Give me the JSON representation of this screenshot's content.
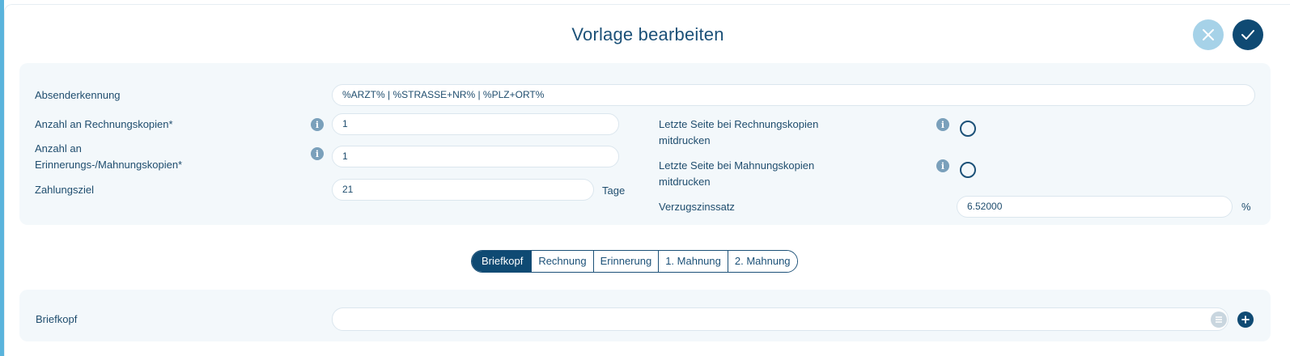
{
  "dialog": {
    "title": "Vorlage bearbeiten",
    "cancel_icon": "close-icon",
    "confirm_icon": "check-icon"
  },
  "form": {
    "absenderkennung_label": "Absenderkennung",
    "absenderkennung_value": "%ARZT% | %STRASSE+NR% | %PLZ+ORT%",
    "rechnungskopien_label": "Anzahl an Rechnungskopien*",
    "rechnungskopien_value": "1",
    "mahnungskopien_label_line1": "Anzahl an",
    "mahnungskopien_label_line2": "Erinnerungs-/Mahnungskopien*",
    "mahnungskopien_value": "1",
    "zahlungsziel_label": "Zahlungsziel",
    "zahlungsziel_value": "21",
    "zahlungsziel_unit": "Tage",
    "letzte_rechnung_label_line1": "Letzte Seite bei Rechnungskopien",
    "letzte_rechnung_label_line2": "mitdrucken",
    "letzte_mahnung_label_line1": "Letzte Seite bei Mahnungskopien",
    "letzte_mahnung_label_line2": "mitdrucken",
    "verzugszinssatz_label": "Verzugszinssatz",
    "verzugszinssatz_value": "6.52000",
    "verzugszinssatz_unit": "%",
    "info_glyph": "i"
  },
  "tabs": [
    {
      "label": "Briefkopf",
      "active": true
    },
    {
      "label": "Rechnung",
      "active": false
    },
    {
      "label": "Erinnerung",
      "active": false
    },
    {
      "label": "1. Mahnung",
      "active": false
    },
    {
      "label": "2. Mahnung",
      "active": false
    }
  ],
  "briefkopf": {
    "label": "Briefkopf",
    "value": "",
    "list_icon": "list-icon",
    "add_icon": "add-icon"
  },
  "colors": {
    "primary": "#0f4a73",
    "primary_light": "#a6d2e8",
    "panel_bg": "#f3f8fb",
    "side_strip": "#5ab4dc"
  }
}
